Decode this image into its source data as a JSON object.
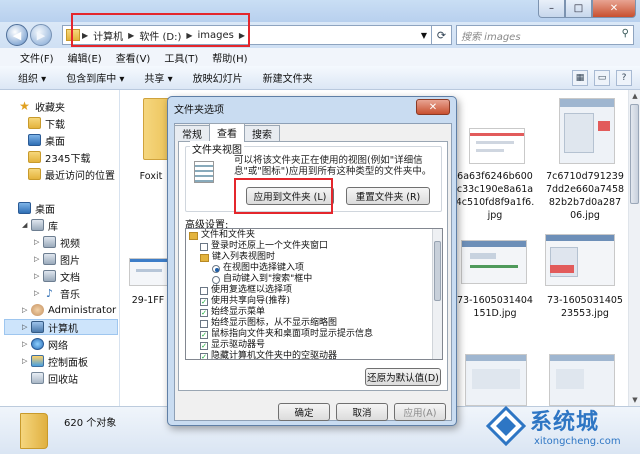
{
  "explorer": {
    "breadcrumb": [
      "计算机",
      "软件 (D:)",
      "images"
    ],
    "search_placeholder": "搜索 images",
    "menu": [
      "文件(F)",
      "编辑(E)",
      "查看(V)",
      "工具(T)",
      "帮助(H)"
    ],
    "toolbar": [
      "组织 ▾",
      "包含到库中 ▾",
      "共享 ▾",
      "放映幻灯片",
      "新建文件夹"
    ],
    "nav": {
      "favorites": "收藏夹",
      "downloads": "下载",
      "desktop_fav": "桌面",
      "downloads2345": "2345下载",
      "recent": "最近访问的位置",
      "desktop": "桌面",
      "libraries": "库",
      "videos": "视频",
      "pictures": "图片",
      "documents": "文档",
      "music": "音乐",
      "administrator": "Administrator",
      "computer": "计算机",
      "network": "网络",
      "control_panel": "控制面板",
      "recycle_bin": "回收站"
    },
    "files": {
      "folder_label": "Foxit",
      "f_left_mid": "29-1FF",
      "f_1": [
        "6a63f6246b600",
        "c33c190e8a61a",
        "4c510fd8f9a1f6.",
        "jpg"
      ],
      "f_2": [
        "7c6710d791239",
        "7dd2e660a7458",
        "82b2b7d0a287",
        "06.jpg"
      ],
      "f_3": [
        "73-1605031404",
        "151D.jpg"
      ],
      "f_4": [
        "73-1605031405",
        "23553.jpg"
      ]
    },
    "status_count": "620 个对象"
  },
  "dialog": {
    "title": "文件夹选项",
    "tabs": [
      "常规",
      "查看",
      "搜索"
    ],
    "folder_views_title": "文件夹视图",
    "folder_views_desc": "可以将该文件夹正在使用的视图(例如\"详细信息\"或\"图标\")应用到所有这种类型的文件夹中。",
    "apply_btn": "应用到文件夹 (L)",
    "reset_btn": "重置文件夹 (R)",
    "advanced_label": "高级设置:",
    "tree": [
      "文件和文件夹",
      "登录时还原上一个文件夹窗口",
      "键入列表视图时",
      "在视图中选择键入项",
      "自动键入到\"搜索\"框中",
      "使用复选框以选择项",
      "使用共享向导(推荐)",
      "始终显示菜单",
      "始终显示图标，从不显示缩略图",
      "鼠标指向文件夹和桌面项时显示提示信息",
      "显示驱动器号",
      "隐藏计算机文件夹中的空驱动器",
      "隐藏受保护的操作系统文件(推荐)"
    ],
    "restore_btn": "还原为默认值(D)",
    "ok_btn": "确定",
    "cancel_btn": "取消",
    "apply_footer_btn": "应用(A)"
  },
  "watermark": {
    "brand": "系统城",
    "url": "xitongcheng.com"
  },
  "colors": {
    "highlight_red": "#e4262c",
    "accent_blue": "#2e76c4"
  }
}
